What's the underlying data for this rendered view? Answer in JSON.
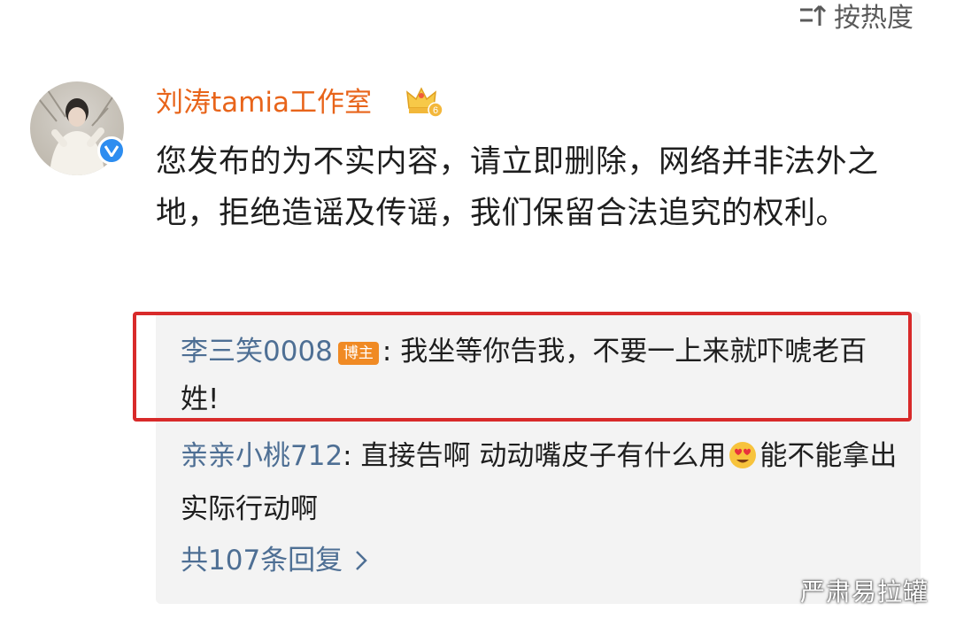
{
  "sort": {
    "label": "按热度",
    "icon": "sort-icon"
  },
  "comment": {
    "username": "刘涛tamia工作室",
    "text": "您发布的为不实内容，请立即删除，网络并非法外之地，拒绝造谣及传谣，我们保留合法追究的权利。",
    "avatar_icon": "avatar",
    "verified_icon": "verified-badge-icon",
    "crown_icon": "crown-icon",
    "crown_level": "6"
  },
  "replies": [
    {
      "user": "李三笑0008",
      "badge": "博主",
      "text": "我坐等你告我，不要一上来就吓唬老百姓!"
    },
    {
      "user": "亲亲小桃712",
      "text_before_emoji": "直接告啊 动动嘴皮子有什么用",
      "emoji": "heart-eyes-emoji",
      "text_after_emoji": "能不能拿出实际行动啊"
    }
  ],
  "more_replies": {
    "label": "共107条回复",
    "icon": "chevron-right-icon"
  },
  "watermark": "严肃易拉罐",
  "colors": {
    "username": "#e8641a",
    "reply_user": "#4e6f94",
    "highlight_box": "#d82a2a",
    "verified": "#2d8df0",
    "host_badge": "#f08a24"
  }
}
